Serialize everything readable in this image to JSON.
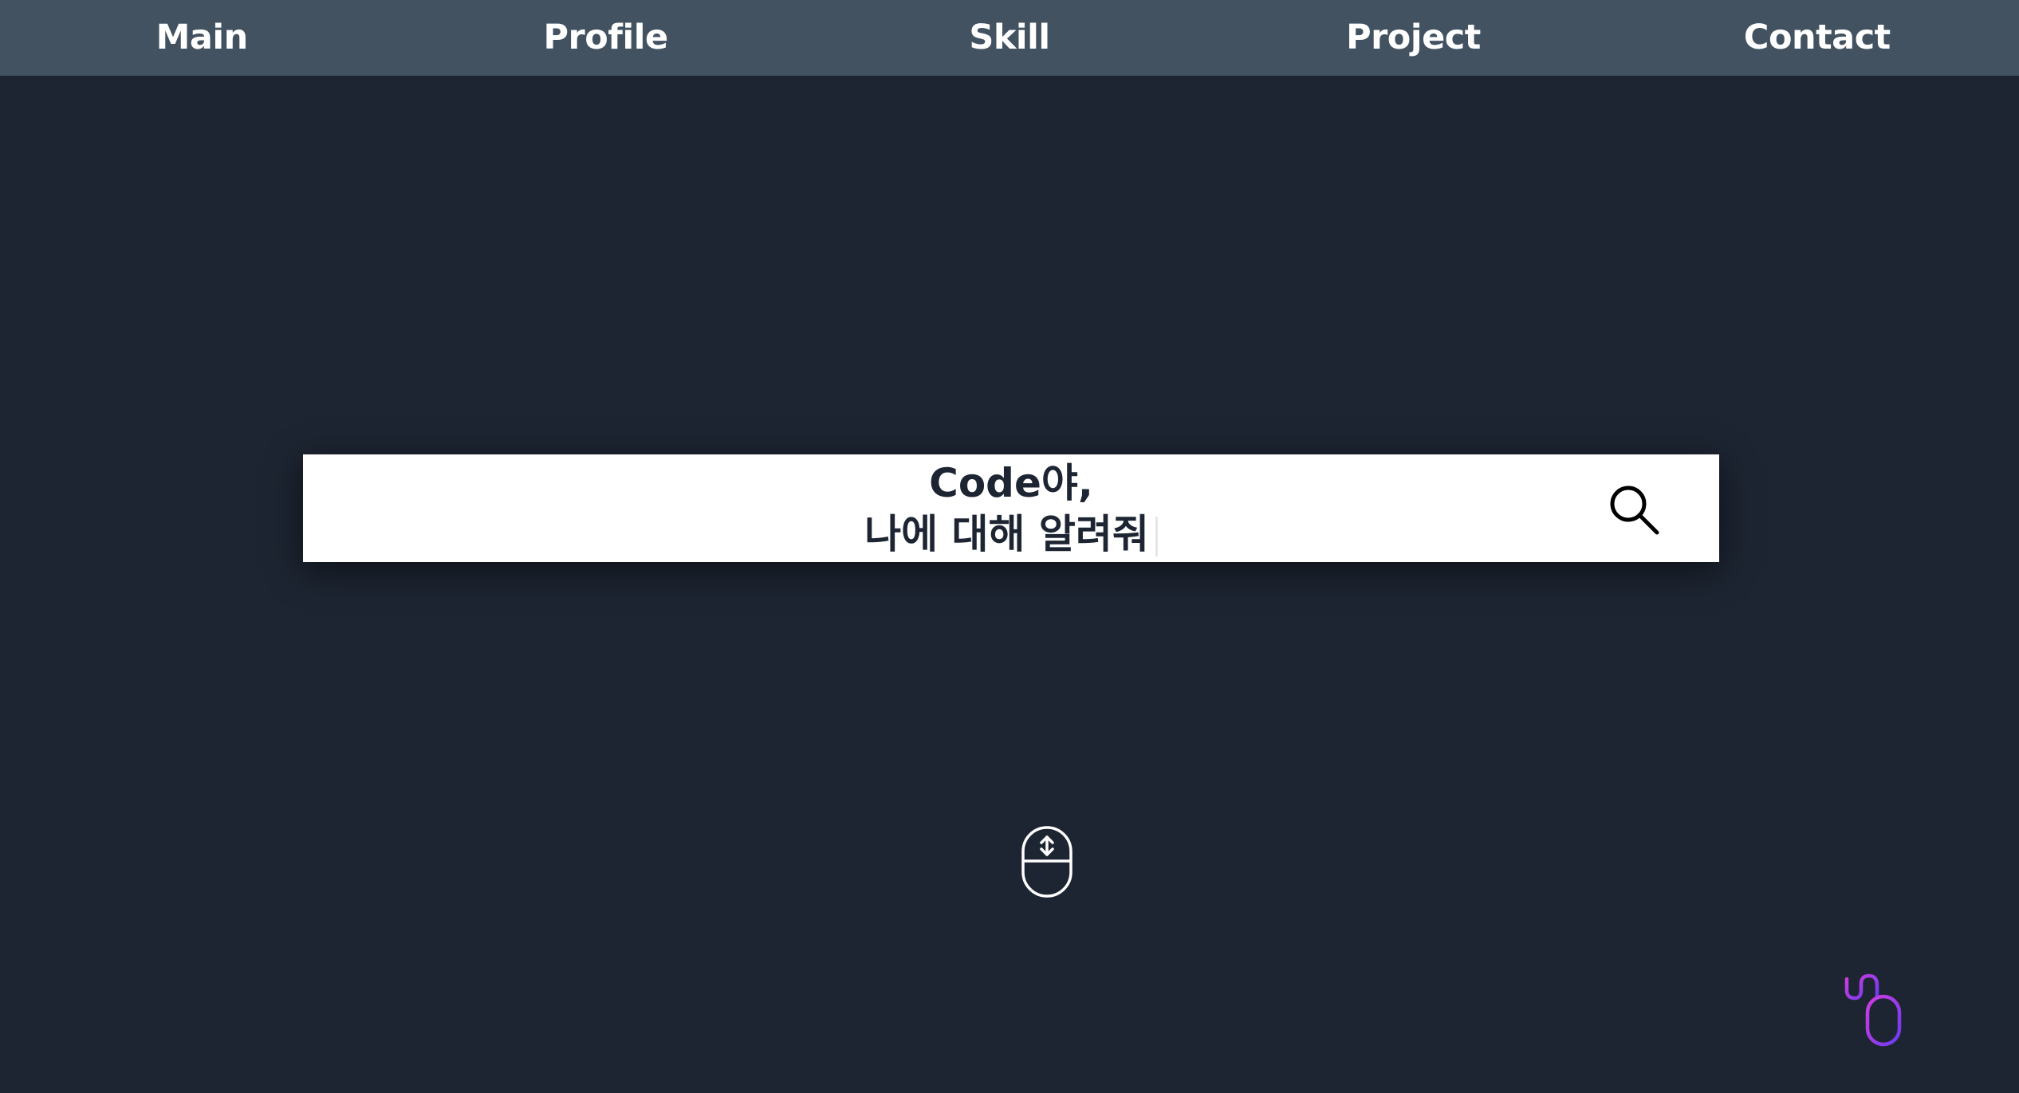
{
  "nav": {
    "items": [
      {
        "label": "Main"
      },
      {
        "label": "Profile"
      },
      {
        "label": "Skill"
      },
      {
        "label": "Project"
      },
      {
        "label": "Contact"
      }
    ]
  },
  "search": {
    "line1": "Code야,",
    "line2": "나에 대해 알려줘"
  },
  "icons": {
    "search": "search-icon",
    "scroll": "scroll-mouse-icon",
    "cursor": "wired-mouse-icon"
  },
  "colors": {
    "background": "#1d2532",
    "navbar": "#435261",
    "accent_purple": "#7b3ff2",
    "accent_magenta": "#c53be6"
  }
}
